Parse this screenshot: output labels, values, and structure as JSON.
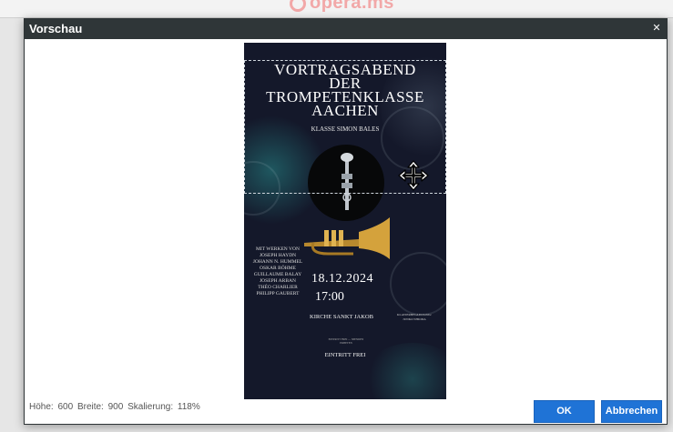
{
  "background": {
    "logo_text": "opera.ms",
    "colors": {
      "page": "#e6e6e6",
      "logo": "#f2a8a8"
    }
  },
  "modal": {
    "title": "Vorschau",
    "close_icon": "close-icon",
    "colors": {
      "titlebar": "#2f3638",
      "button": "#1f73d6"
    }
  },
  "poster": {
    "title_lines": [
      "VORTRAGSABEND",
      "DER",
      "TROMPETENKLASSE",
      "AACHEN"
    ],
    "subtitle": "KLASSE SIMON BALES",
    "works_lines": [
      "MIT WERKEN VON",
      "JOSEPH HAYDN",
      "JOHANN N. HUMMEL",
      "OSKAR BÖHME",
      "GUILLAUME BALAY",
      "JOSEPH ARBAN",
      "THÉO CHARLIER",
      "PHILIPP GAUBERT"
    ],
    "date": "18.12.2024",
    "time": "17:00",
    "venue": "KIRCHE SANKT JAKOB",
    "accompaniment_lines": [
      "KLAVIERBEGLEITUNG:",
      "JUNKO SHIODA"
    ],
    "small_lines": [
      "EINTRITT FREI — SPENDEN",
      "ERBETEN"
    ],
    "entry": "EINTRITT FREI"
  },
  "status": {
    "height_label": "Höhe:",
    "height_value": "600",
    "width_label": "Breite:",
    "width_value": "900",
    "scale_label": "Skalierung:",
    "scale_value": "118%"
  },
  "buttons": {
    "ok_label": "OK",
    "cancel_label": "Abbrechen"
  }
}
